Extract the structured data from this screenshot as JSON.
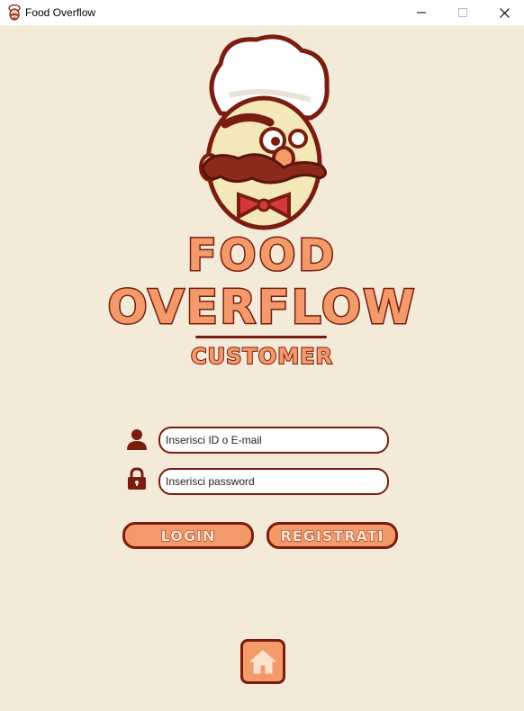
{
  "window": {
    "title": "Food Overflow",
    "controls": [
      "minimize-icon",
      "maximize-icon",
      "close-icon"
    ]
  },
  "brand": {
    "line1": "FOOD",
    "line2": "OVERFLOW",
    "subtitle": "CUSTOMER"
  },
  "form": {
    "id_placeholder": "Inserisci ID o E-mail",
    "password_placeholder": "Inserisci password",
    "id_icon": "user-icon",
    "password_icon": "lock-icon"
  },
  "actions": {
    "login_label": "LOGIN",
    "register_label": "REGISTRATI",
    "home_icon": "home-icon"
  },
  "colors": {
    "background": "#f3ead8",
    "accent": "#f39a6b",
    "outline": "#7a1c10"
  }
}
